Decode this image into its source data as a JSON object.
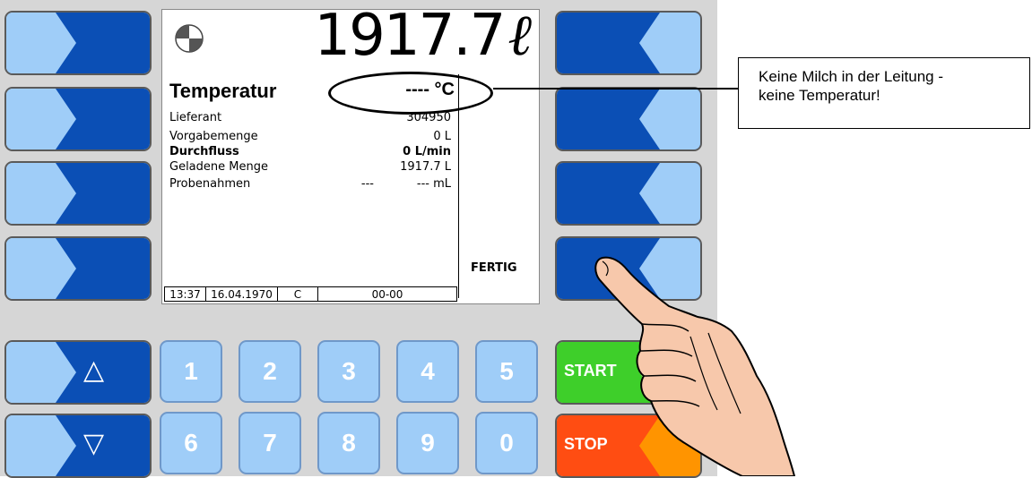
{
  "display": {
    "volume_value": "1917.7",
    "volume_unit": "ℓ",
    "mode_icon": "rotation-disc-icon",
    "temperature_title": "Temperatur",
    "temperature_value": "---- °C",
    "rows": [
      {
        "label": "Lieferant",
        "value": "304950"
      },
      {
        "label": "Vorgabemenge",
        "value": "0 L"
      },
      {
        "label": "Durchfluss",
        "value": "0 L/min"
      },
      {
        "label": "Geladene Menge",
        "value": "1917.7 L"
      },
      {
        "label": "Probenahmen",
        "value_a": "---",
        "value_b": "--- mL"
      }
    ],
    "softkey_label_4": "FERTIG",
    "status": {
      "time": "13:37",
      "date": "16.04.1970",
      "mode": "C",
      "code": "00-00"
    }
  },
  "keypad": {
    "up_symbol": "△",
    "down_symbol": "▽",
    "digits_row1": [
      "1",
      "2",
      "3",
      "4",
      "5"
    ],
    "digits_row2": [
      "6",
      "7",
      "8",
      "9",
      "0"
    ],
    "start_label": "START",
    "stop_label": "STOP"
  },
  "callout": {
    "line1": "Keine Milch in der Leitung -",
    "line2": "keine Temperatur!"
  },
  "colors": {
    "key_dark_blue": "#0b4fb5",
    "key_light_blue": "#9fcdf8",
    "start_green": "#3ecf2a",
    "stop_orange": "#ff9400",
    "stop_red": "#ff4d12"
  }
}
